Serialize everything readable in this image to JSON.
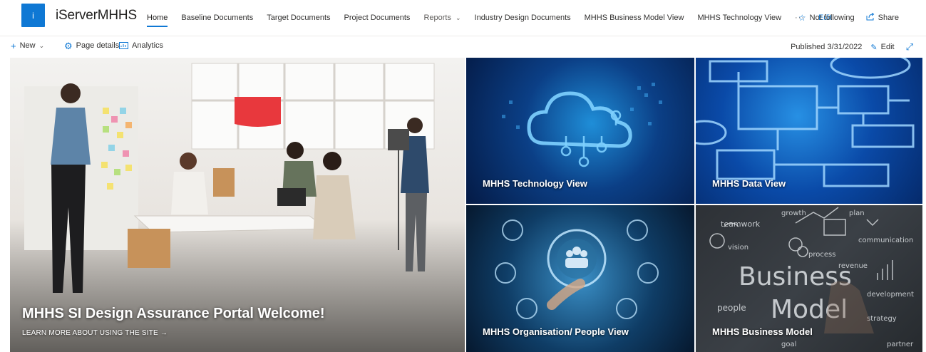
{
  "site": {
    "logo_letter": "i",
    "title": "iServerMHHS"
  },
  "nav": {
    "items": [
      {
        "label": "Home",
        "active": true
      },
      {
        "label": "Baseline Documents"
      },
      {
        "label": "Target Documents"
      },
      {
        "label": "Project Documents"
      },
      {
        "label": "Reports"
      },
      {
        "label": "Industry Design Documents"
      },
      {
        "label": "MHHS Business Model View"
      },
      {
        "label": "MHHS Technology View"
      }
    ],
    "more_label": "···",
    "edit_label": "Edit"
  },
  "header_actions": {
    "follow_label": "Not following",
    "share_label": "Share"
  },
  "command_bar": {
    "new_label": "New",
    "page_details_label": "Page details",
    "analytics_label": "Analytics",
    "published_label": "Published 3/31/2022",
    "edit_label": "Edit"
  },
  "hero": {
    "main_title": "MHHS SI Design Assurance Portal Welcome!",
    "main_link": "LEARN MORE ABOUT USING THE SITE →",
    "tiles": [
      {
        "label": "MHHS Technology View"
      },
      {
        "label": "MHHS Data View"
      },
      {
        "label": "MHHS Organisation/ People View"
      },
      {
        "label": "MHHS Business Model"
      }
    ]
  },
  "background_overlay_text": [
    "teamwork",
    "vision",
    "communication",
    "Business",
    "Model",
    "people",
    "development",
    "revenue",
    "process",
    "plan",
    "growth",
    "partner",
    "goal",
    "strategy"
  ],
  "colors": {
    "accent": "#0f78d4",
    "text": "#323130"
  },
  "icons": {
    "follow": "star-icon",
    "share": "share-icon",
    "new": "plus-icon",
    "page_details": "gear-icon",
    "analytics": "analytics-icon",
    "edit": "pencil-icon",
    "expand": "expand-icon"
  }
}
